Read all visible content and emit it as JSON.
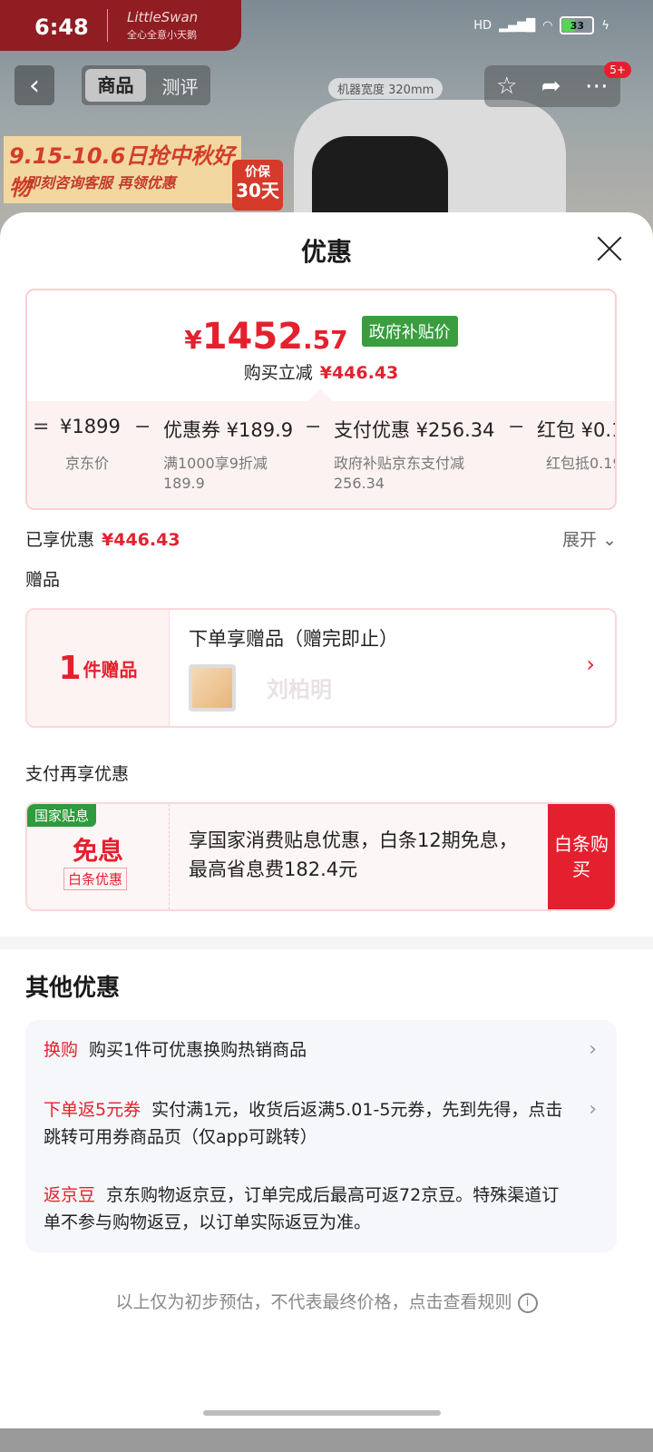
{
  "status": {
    "time": "6:48",
    "network": "HD",
    "battery": "33"
  },
  "background": {
    "brand": "LittleSwan",
    "brand_sub": "全心全意小天鹅",
    "tabs": [
      "商品",
      "测评"
    ],
    "badge_count": "5+",
    "promo_line1": "9.15-10.6日抢中秋好物",
    "promo_line2": "即刻咨询客服 再领优惠",
    "price_protect": "价保",
    "price_protect_days": "30天",
    "width_label": "机器宽度 320mm"
  },
  "sheet": {
    "title": "优惠",
    "price": {
      "currency": "¥",
      "integer": "1452",
      "decimal": ".57",
      "tag": "政府补贴价"
    },
    "save_line": {
      "label": "购买立减",
      "value": "¥446.43"
    },
    "breakdown": [
      {
        "op": "=",
        "label": "¥1899",
        "sub": "京东价"
      },
      {
        "op": "−",
        "label": "优惠券 ¥189.9",
        "sub": "满1000享9折减",
        "sub2": "189.9"
      },
      {
        "op": "−",
        "label": "支付优惠 ¥256.34",
        "sub": "政府补贴京东支付减",
        "sub2": "256.34"
      },
      {
        "op": "−",
        "label": "红包 ¥0.1",
        "sub": "红包抵0.19"
      }
    ],
    "enjoyed": {
      "label": "已享优惠",
      "value": "¥446.43",
      "expand": "展开"
    },
    "gift": {
      "section_label": "赠品",
      "count": "1",
      "count_suffix": "件赠品",
      "title": "下单享赠品（赠完即止）",
      "name": "刘柏明"
    },
    "pay": {
      "section_label": "支付再享优惠",
      "tag": "国家贴息",
      "main": "免息",
      "sub_tag": "白条优惠",
      "text": "享国家消费贴息优惠，白条12期免息，最高省息费182.4元",
      "button": "白条购买"
    },
    "other": {
      "title": "其他优惠",
      "items": [
        {
          "key": "换购",
          "text": "购买1件可优惠换购热销商品"
        },
        {
          "key": "下单返5元券",
          "text": "实付满1元，收货后返满5.01-5元券，先到先得，点击跳转可用券商品页（仅app可跳转）"
        },
        {
          "key": "返京豆",
          "text": "京东购物返京豆，订单完成后最高可返72京豆。特殊渠道订单不参与购物返豆，以订单实际返豆为准。"
        }
      ]
    },
    "footnote": "以上仅为初步预估，不代表最终价格，点击查看规则"
  },
  "colors": {
    "accent": "#e5202e",
    "gov_green": "#3a9d3e",
    "sheet_bg": "#ffffff"
  }
}
